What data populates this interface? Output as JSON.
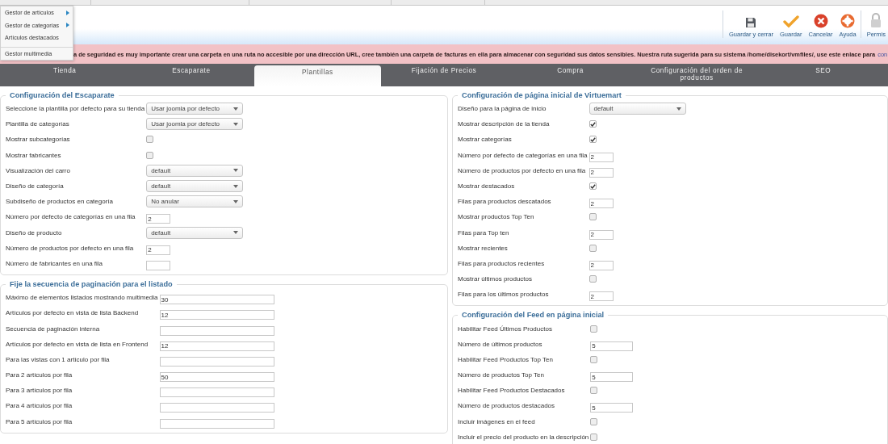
{
  "menu": [
    {
      "label": "Gestor de artículos",
      "submenu": true,
      "separated": false
    },
    {
      "label": "Gestor de categorías",
      "submenu": true,
      "separated": false
    },
    {
      "label": "Artículos destacados",
      "submenu": false,
      "separated": false
    },
    {
      "label": "Gestor multimedia",
      "submenu": false,
      "separated": true
    }
  ],
  "toolbar": [
    {
      "kind": "save",
      "label": "Guardar y cerrar"
    },
    {
      "kind": "check",
      "label": "Guardar"
    },
    {
      "kind": "cancel",
      "label": "Cancelar"
    },
    {
      "kind": "help",
      "label": "Ayuda"
    },
    {
      "kind": "lock",
      "label": "Permis"
    }
  ],
  "alert": {
    "text": "a de seguridad es muy importante crear una carpeta en una ruta no accesible por una dirección URL, cree también una carpeta de facturas en ella para almacenar con seguridad sus datos sensibles. Nuestra ruta sugerida para su sistema /home/disekort/vmfiles/, use este enlace para",
    "link": "con"
  },
  "tabs": [
    {
      "label": "Tienda",
      "selected": false
    },
    {
      "label": "Escaparate",
      "selected": false
    },
    {
      "label": "Plantillas",
      "selected": true
    },
    {
      "label": "Fijación de Precios",
      "selected": false
    },
    {
      "label": "Compra",
      "selected": false
    },
    {
      "label": "Configuración del orden de productos",
      "selected": false
    },
    {
      "label": "SEO",
      "selected": false
    }
  ],
  "columns": [
    [
      {
        "legend": "Configuración del Escaparate",
        "rows": [
          {
            "label": "Seleccione la plantilla por defecto para su tienda",
            "kind": "select",
            "value": "Usar joomla por defecto"
          },
          {
            "label": "Plantilla de categorías",
            "kind": "select",
            "value": "Usar joomla por defecto"
          },
          {
            "label": "Mostrar subcategorías",
            "kind": "checkbox",
            "checked": false
          },
          {
            "label": "Mostrar fabricantes",
            "kind": "checkbox",
            "checked": false
          },
          {
            "label": "Visualización del carro",
            "kind": "select",
            "value": "default"
          },
          {
            "label": "Diseño de categoría",
            "kind": "select",
            "value": "default"
          },
          {
            "label": "Subdiseño de productos en categoría",
            "kind": "select",
            "value": "No anular"
          },
          {
            "label": "Número por defecto de categorías en una fila",
            "kind": "text",
            "value": "2"
          },
          {
            "label": "Diseño de producto",
            "kind": "select",
            "value": "default"
          },
          {
            "label": "Número de productos por defecto en una fila",
            "kind": "text",
            "value": "2"
          },
          {
            "label": "Número de fabricantes en una fila",
            "kind": "text"
          }
        ]
      },
      {
        "legend": "Fije la secuencia de paginación para el listado",
        "rows": [
          {
            "label": "Máximo de elementos listados mostrando multimedia",
            "kind": "wide",
            "value": "30"
          },
          {
            "label": "Artículos por defecto en vista de lista Backend",
            "kind": "wide",
            "value": "12"
          },
          {
            "label": "Secuencia de paginación interna",
            "kind": "wide"
          },
          {
            "label": "Artículos por defecto en vista de lista en Frontend",
            "kind": "wide",
            "value": "12"
          },
          {
            "label": "Para las vistas con 1 artículo por fila",
            "kind": "wide"
          },
          {
            "label": "Para 2 artículos por fila",
            "kind": "wide",
            "value": "50"
          },
          {
            "label": "Para 3 artículos por fila",
            "kind": "wide"
          },
          {
            "label": "Para 4 artículos por fila",
            "kind": "wide"
          },
          {
            "label": "Para 5 artículos por fila",
            "kind": "wide"
          }
        ]
      }
    ],
    [
      {
        "legend": "Configuración de página inicial de Virtuemart",
        "rows": [
          {
            "label": "Diseño para la página de inicio",
            "kind": "select",
            "value": "default"
          },
          {
            "label": "Mostrar descripción de la tienda",
            "kind": "checkbox",
            "checked": true
          },
          {
            "label": "Mostrar categorías",
            "kind": "checkbox",
            "checked": true
          },
          {
            "label": "Número por defecto de categorías en una fila",
            "kind": "text",
            "value": "2"
          },
          {
            "label": "Número de productos por defecto en una fila",
            "kind": "text",
            "value": "2"
          },
          {
            "label": "Mostrar destacados",
            "kind": "checkbox",
            "checked": true
          },
          {
            "label": "Filas para productos descatados",
            "kind": "text",
            "value": "2"
          },
          {
            "label": "Mostrar productos Top Ten",
            "kind": "checkbox",
            "checked": false
          },
          {
            "label": "Filas para Top ten",
            "kind": "text",
            "value": "2"
          },
          {
            "label": "Mostrar recientes",
            "kind": "checkbox",
            "checked": false
          },
          {
            "label": "Filas para productos recientes",
            "kind": "text",
            "value": "2"
          },
          {
            "label": "Mostrar últimos productos",
            "kind": "checkbox",
            "checked": false
          },
          {
            "label": "Filas para los últimos productos",
            "kind": "text",
            "value": "2"
          }
        ]
      },
      {
        "legend": "Configuración del Feed en página inicial",
        "rows": [
          {
            "label": "Habilitar Feed Últimos Productos",
            "kind": "checkbox",
            "checked": false
          },
          {
            "label": "Número de últimos productos",
            "kind": "medium",
            "value": "5"
          },
          {
            "label": "Habilitar Feed Productos Top Ten",
            "kind": "checkbox",
            "checked": false
          },
          {
            "label": "Número de productos Top Ten",
            "kind": "medium",
            "value": "5"
          },
          {
            "label": "Habilitar Feed Productos Destacados",
            "kind": "checkbox",
            "checked": false
          },
          {
            "label": "Número de productos destacados",
            "kind": "medium",
            "value": "5"
          },
          {
            "label": "Incluir imágenes en el feed",
            "kind": "checkbox",
            "checked": false
          },
          {
            "label": "Incluir el precio del producto en la descripción",
            "kind": "checkbox",
            "checked": false
          }
        ]
      }
    ]
  ]
}
